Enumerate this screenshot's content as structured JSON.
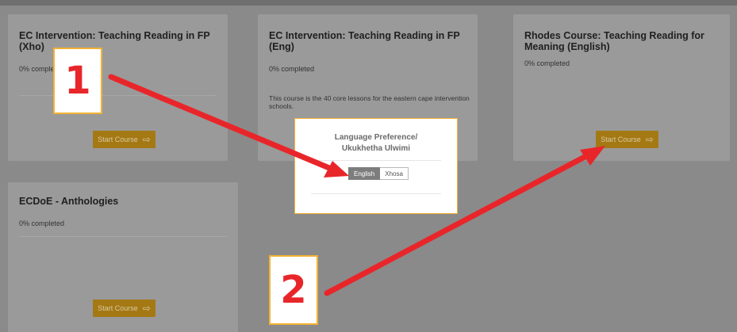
{
  "courses": [
    {
      "title": "EC Intervention: Teaching Reading in FP (Xho)",
      "progress": "0% completed",
      "button": "Start Course"
    },
    {
      "title": "EC Intervention: Teaching Reading in FP (Eng)",
      "progress": "0% completed",
      "description": "This course is the 40 core lessons for the eastern cape intervention schools."
    },
    {
      "title": "Rhodes Course: Teaching Reading for Meaning (English)",
      "progress": "0% completed",
      "button": "Start Course"
    },
    {
      "title": "ECDoE - Anthologies",
      "progress": "0% completed",
      "button": "Start Course"
    }
  ],
  "modal": {
    "title_line1": "Language Preference/",
    "title_line2": "Ukukhetha Ulwimi",
    "options": [
      "English",
      "Xhosa"
    ],
    "selected": "English"
  },
  "annotations": {
    "label1": "1",
    "label2": "2",
    "arrow_color": "#e8262a"
  },
  "icons": {
    "start_arrow": "arrow-right-icon"
  },
  "colors": {
    "button": "#a47914",
    "modal_border": "#f2b233",
    "overlay": "#8a8a8a"
  }
}
